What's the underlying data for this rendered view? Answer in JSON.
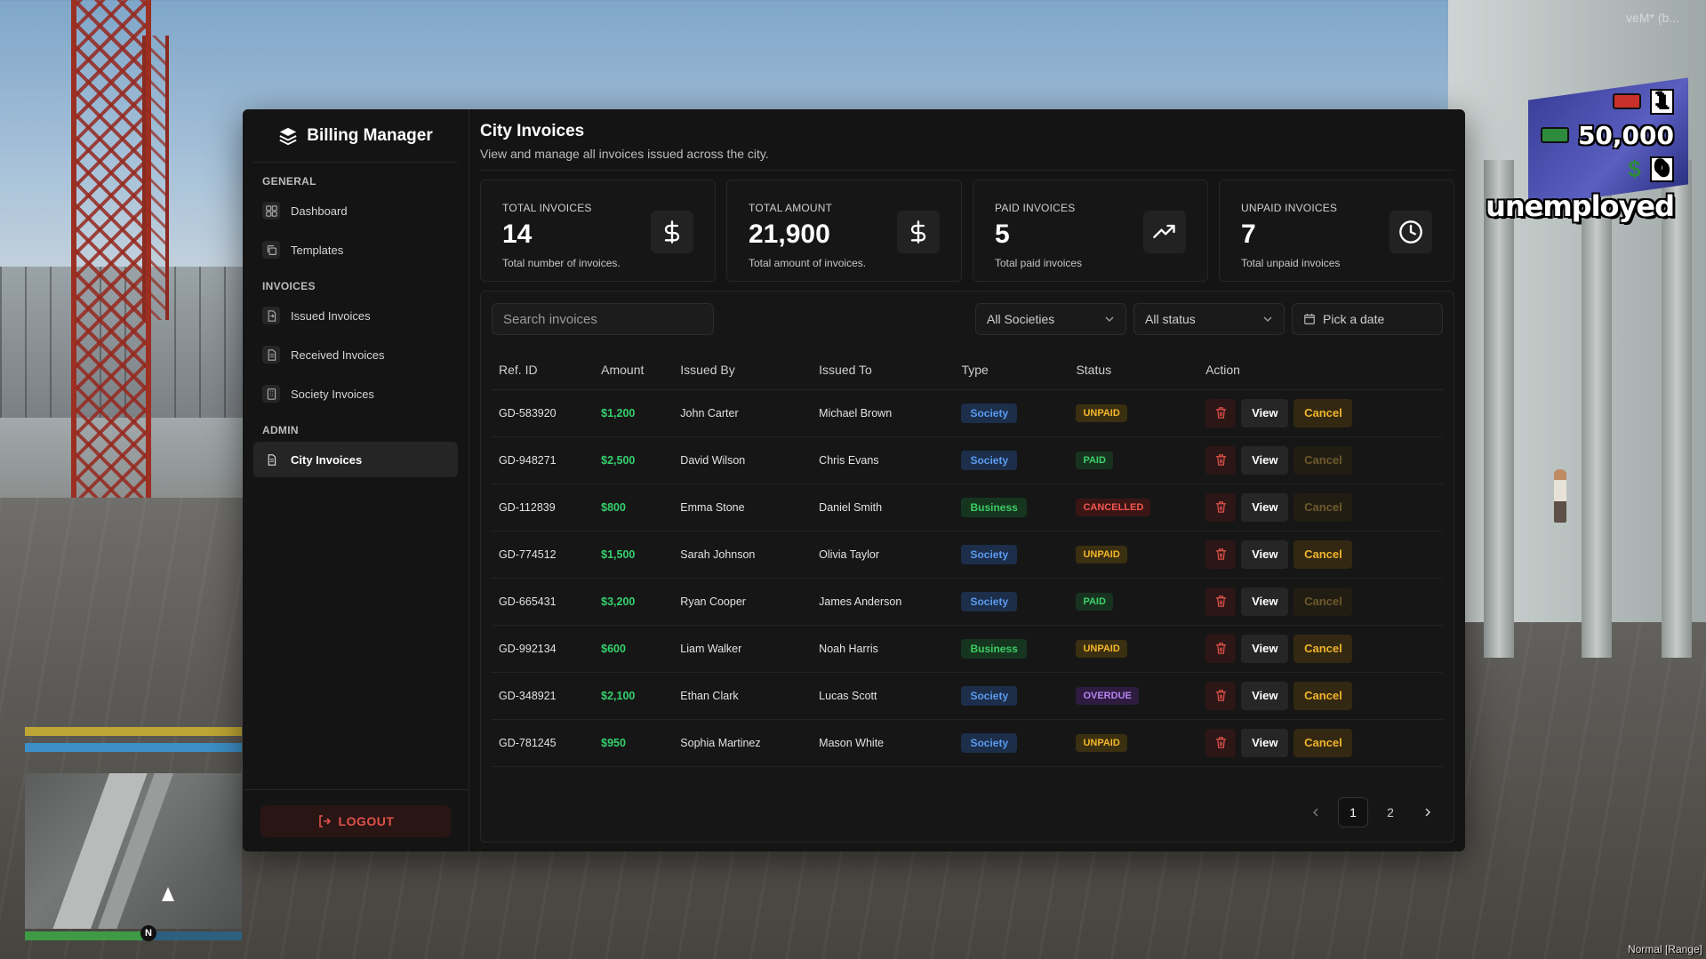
{
  "hud": {
    "faint_text": "veM* (b...",
    "dirty_money": "1",
    "cash": "50,000",
    "bank": "0",
    "job": "unemployed",
    "status": "Normal [Range]",
    "compass": "N"
  },
  "brand": {
    "title": "Billing Manager"
  },
  "sidebar": {
    "groups": [
      {
        "heading": "GENERAL",
        "items": [
          {
            "label": "Dashboard",
            "icon": "grid-icon"
          },
          {
            "label": "Templates",
            "icon": "copy-icon"
          }
        ]
      },
      {
        "heading": "INVOICES",
        "items": [
          {
            "label": "Issued Invoices",
            "icon": "file-out-icon"
          },
          {
            "label": "Received Invoices",
            "icon": "file-text-icon"
          },
          {
            "label": "Society Invoices",
            "icon": "building-icon"
          }
        ]
      },
      {
        "heading": "ADMIN",
        "items": [
          {
            "label": "City Invoices",
            "icon": "file-icon",
            "active": true
          }
        ]
      }
    ],
    "logout_label": "LOGOUT"
  },
  "header": {
    "title": "City Invoices",
    "subtitle": "View and manage all invoices issued across the city."
  },
  "stats": [
    {
      "label": "TOTAL INVOICES",
      "value": "14",
      "desc": "Total number of invoices.",
      "icon": "dollar-icon"
    },
    {
      "label": "TOTAL AMOUNT",
      "value": "21,900",
      "desc": "Total amount of invoices.",
      "icon": "dollar-icon"
    },
    {
      "label": "PAID INVOICES",
      "value": "5",
      "desc": "Total paid invoices",
      "icon": "trending-up-icon"
    },
    {
      "label": "UNPAID INVOICES",
      "value": "7",
      "desc": "Total unpaid invoices",
      "icon": "clock-icon"
    }
  ],
  "filters": {
    "search_placeholder": "Search invoices",
    "societies": "All Societies",
    "status": "All status",
    "date": "Pick a date"
  },
  "table": {
    "columns": [
      "Ref. ID",
      "Amount",
      "Issued By",
      "Issued To",
      "Type",
      "Status",
      "Action"
    ],
    "rows": [
      {
        "ref": "GD-583920",
        "amount": "$1,200",
        "by": "John Carter",
        "to": "Michael Brown",
        "type": "Society",
        "status": "UNPAID",
        "cancel_enabled": true
      },
      {
        "ref": "GD-948271",
        "amount": "$2,500",
        "by": "David Wilson",
        "to": "Chris Evans",
        "type": "Society",
        "status": "PAID",
        "cancel_enabled": false
      },
      {
        "ref": "GD-112839",
        "amount": "$800",
        "by": "Emma Stone",
        "to": "Daniel Smith",
        "type": "Business",
        "status": "CANCELLED",
        "cancel_enabled": false
      },
      {
        "ref": "GD-774512",
        "amount": "$1,500",
        "by": "Sarah Johnson",
        "to": "Olivia Taylor",
        "type": "Society",
        "status": "UNPAID",
        "cancel_enabled": true
      },
      {
        "ref": "GD-665431",
        "amount": "$3,200",
        "by": "Ryan Cooper",
        "to": "James Anderson",
        "type": "Society",
        "status": "PAID",
        "cancel_enabled": false
      },
      {
        "ref": "GD-992134",
        "amount": "$600",
        "by": "Liam Walker",
        "to": "Noah Harris",
        "type": "Business",
        "status": "UNPAID",
        "cancel_enabled": true
      },
      {
        "ref": "GD-348921",
        "amount": "$2,100",
        "by": "Ethan Clark",
        "to": "Lucas Scott",
        "type": "Society",
        "status": "OVERDUE",
        "cancel_enabled": true
      },
      {
        "ref": "GD-781245",
        "amount": "$950",
        "by": "Sophia Martinez",
        "to": "Mason White",
        "type": "Society",
        "status": "UNPAID",
        "cancel_enabled": true
      }
    ],
    "view_label": "View",
    "cancel_label": "Cancel"
  },
  "pagination": {
    "pages": [
      "1",
      "2"
    ],
    "current": "1"
  },
  "colors": {
    "panel": "#141414",
    "accent_green": "#35d06d",
    "accent_red": "#e0514a",
    "accent_yellow": "#f0b42a"
  }
}
